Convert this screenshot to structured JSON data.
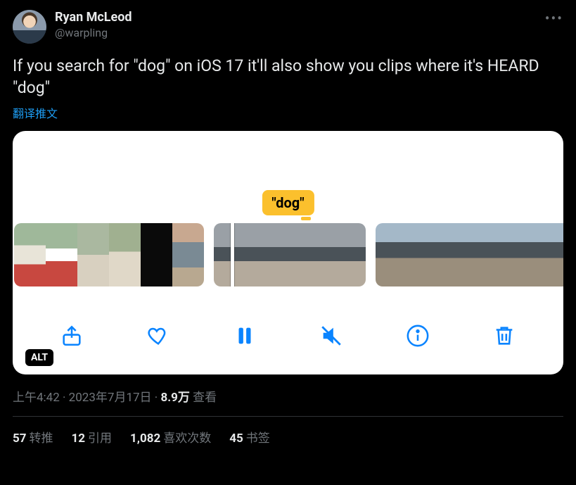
{
  "author": {
    "displayName": "Ryan McLeod",
    "username": "@warpling"
  },
  "tweet": {
    "text": "If you search for \"dog\" on iOS 17 it'll also show you clips where it's HEARD \"dog\"",
    "translateLabel": "翻译推文"
  },
  "media": {
    "tooltipLabel": "\"dog\"",
    "altBadge": "ALT"
  },
  "meta": {
    "time": "上午4:42",
    "date": "2023年7月17日",
    "viewsCount": "8.9万",
    "viewsLabel": "查看"
  },
  "stats": {
    "retweets": {
      "count": "57",
      "label": "转推"
    },
    "quotes": {
      "count": "12",
      "label": "引用"
    },
    "likes": {
      "count": "1,082",
      "label": "喜欢次数"
    },
    "bookmarks": {
      "count": "45",
      "label": "书签"
    }
  }
}
